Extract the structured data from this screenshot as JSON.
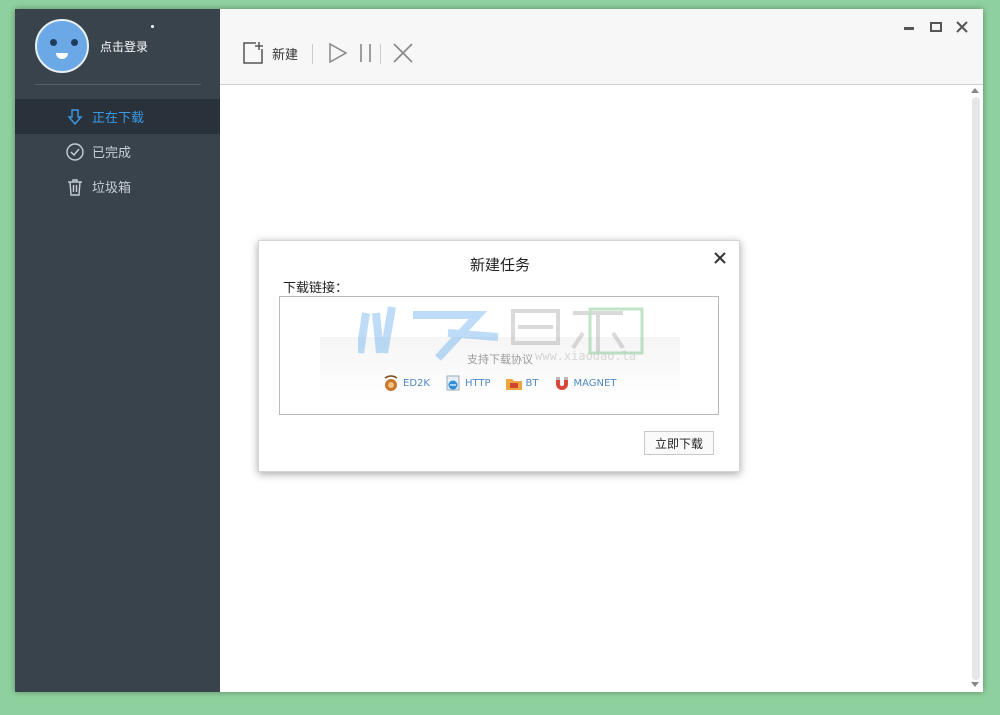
{
  "profile": {
    "login_text": "点击登录"
  },
  "sidebar": {
    "items": [
      {
        "label": "正在下载",
        "icon": "download-arrow-icon",
        "active": true
      },
      {
        "label": "已完成",
        "icon": "check-circle-icon",
        "active": false
      },
      {
        "label": "垃圾箱",
        "icon": "trash-icon",
        "active": false
      }
    ]
  },
  "toolbar": {
    "new_label": "新建"
  },
  "dialog": {
    "title": "新建任务",
    "link_label": "下载链接：",
    "hint": "支持下载协议",
    "watermark_url": "www.xiaodao.la",
    "protocols": [
      "ED2K",
      "HTTP",
      "BT",
      "MAGNET"
    ],
    "submit_label": "立即下载"
  },
  "colors": {
    "sidebar_bg": "#39434c",
    "sidebar_active_bg": "#29313a",
    "accent": "#3a9be8",
    "backdrop": "#8fd19e"
  }
}
